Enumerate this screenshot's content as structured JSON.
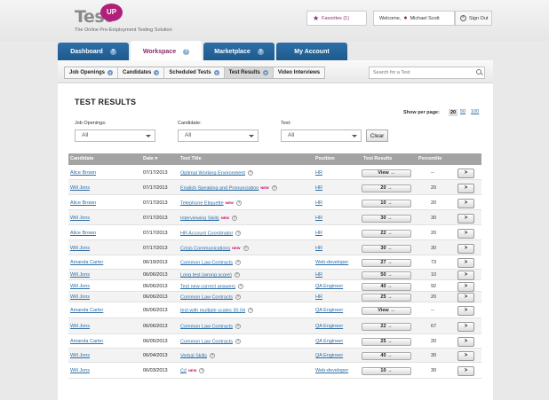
{
  "header": {
    "logo_text": "Test",
    "logo_badge": "UP",
    "tagline": "The Online Pre-Employment Testing Solution",
    "favorites": "Favorites (1)",
    "welcome": "Welcome,",
    "user_name": "Michael Scott",
    "sign_out": "Sign Out"
  },
  "main_tabs": [
    {
      "label": "Dashboard"
    },
    {
      "label": "Workspace"
    },
    {
      "label": "Marketplace"
    },
    {
      "label": "My Account"
    }
  ],
  "sub_tabs": [
    {
      "label": "Job Openings"
    },
    {
      "label": "Candidates"
    },
    {
      "label": "Scheduled Tests"
    },
    {
      "label": "Test Results"
    },
    {
      "label": "Video Interviews"
    }
  ],
  "search": {
    "placeholder": "Search for a Test"
  },
  "page": {
    "title": "TEST RESULTS",
    "per_page_label": "Show per page:",
    "per_page_options": [
      "20",
      "50",
      "100"
    ],
    "per_page_selected": "20"
  },
  "filters": {
    "job_openings_label": "Job Openings:",
    "job_openings_value": "All",
    "candidate_label": "Candidate:",
    "candidate_value": "All",
    "test_label": "Test:",
    "test_value": "All",
    "clear_label": "Clear"
  },
  "table": {
    "headers": {
      "candidate": "Candidate",
      "date": "Date ▾",
      "test_title": "Test Title",
      "position": "Position",
      "test_results": "Test Results",
      "percentile": "Percentile"
    },
    "new_badge": "NEW",
    "view_label": "View",
    "go_label": ">",
    "rows": [
      {
        "candidate": "Alice Brown",
        "date": "07/17/2013",
        "test": "Optimal Working Environment",
        "new": false,
        "position": "HR",
        "result": "View",
        "percentile": "--"
      },
      {
        "candidate": "Will Jons",
        "date": "07/17/2013",
        "test": "English Speaking and Pronunciation",
        "new": true,
        "position": "HR",
        "result": "20",
        "percentile": "20"
      },
      {
        "candidate": "Alice Brown",
        "date": "07/17/2013",
        "test": "Telephone Etiquette",
        "new": true,
        "position": "HR",
        "result": "10",
        "percentile": "20"
      },
      {
        "candidate": "Will Jons",
        "date": "07/17/2013",
        "test": "Interviewing Skills",
        "new": true,
        "position": "HR",
        "result": "30",
        "percentile": "30"
      },
      {
        "candidate": "Alice Brown",
        "date": "07/17/2013",
        "test": "HR Account Coordinator",
        "new": false,
        "position": "HR",
        "result": "22",
        "percentile": "20"
      },
      {
        "candidate": "Will Jons",
        "date": "07/17/2013",
        "test": "Crisis Communications",
        "new": true,
        "position": "HR",
        "result": "30",
        "percentile": "30"
      },
      {
        "candidate": "Amanda Carter",
        "date": "06/19/2013",
        "test": "Common Law Contracts",
        "new": false,
        "position": "Web-developer",
        "result": "27",
        "percentile": "73"
      },
      {
        "candidate": "Will Jons",
        "date": "06/06/2013",
        "test": "Long test (wrong score)",
        "new": false,
        "position": "HR",
        "result": "50",
        "percentile": "10"
      },
      {
        "candidate": "Will Jons",
        "date": "06/06/2013",
        "test": "Test new correct answers",
        "new": false,
        "position": "QA Engineer",
        "result": "40",
        "percentile": "92"
      },
      {
        "candidate": "Will Jons",
        "date": "06/06/2013",
        "test": "Common Law Contracts",
        "new": false,
        "position": "HR",
        "result": "25",
        "percentile": "20"
      },
      {
        "candidate": "Amanda Carter",
        "date": "06/06/2013",
        "test": "test with multiple scales 30.04",
        "new": false,
        "position": "QA Engineer",
        "result": "View",
        "percentile": "--"
      },
      {
        "candidate": "Will Jons",
        "date": "06/06/2013",
        "test": "Common Law Contracts",
        "new": false,
        "position": "QA Engineer",
        "result": "22",
        "percentile": "67"
      },
      {
        "candidate": "Amanda Carter",
        "date": "06/05/2013",
        "test": "Common Law Contracts",
        "new": false,
        "position": "QA Engineer",
        "result": "25",
        "percentile": "20"
      },
      {
        "candidate": "Will Jons",
        "date": "06/04/2013",
        "test": "Verbal Skills",
        "new": false,
        "position": "QA Engineer",
        "result": "40",
        "percentile": "30"
      },
      {
        "candidate": "Will Jons",
        "date": "06/03/2013",
        "test": "C#",
        "new": true,
        "position": "Web-developer",
        "result": "10",
        "percentile": "30"
      }
    ]
  }
}
